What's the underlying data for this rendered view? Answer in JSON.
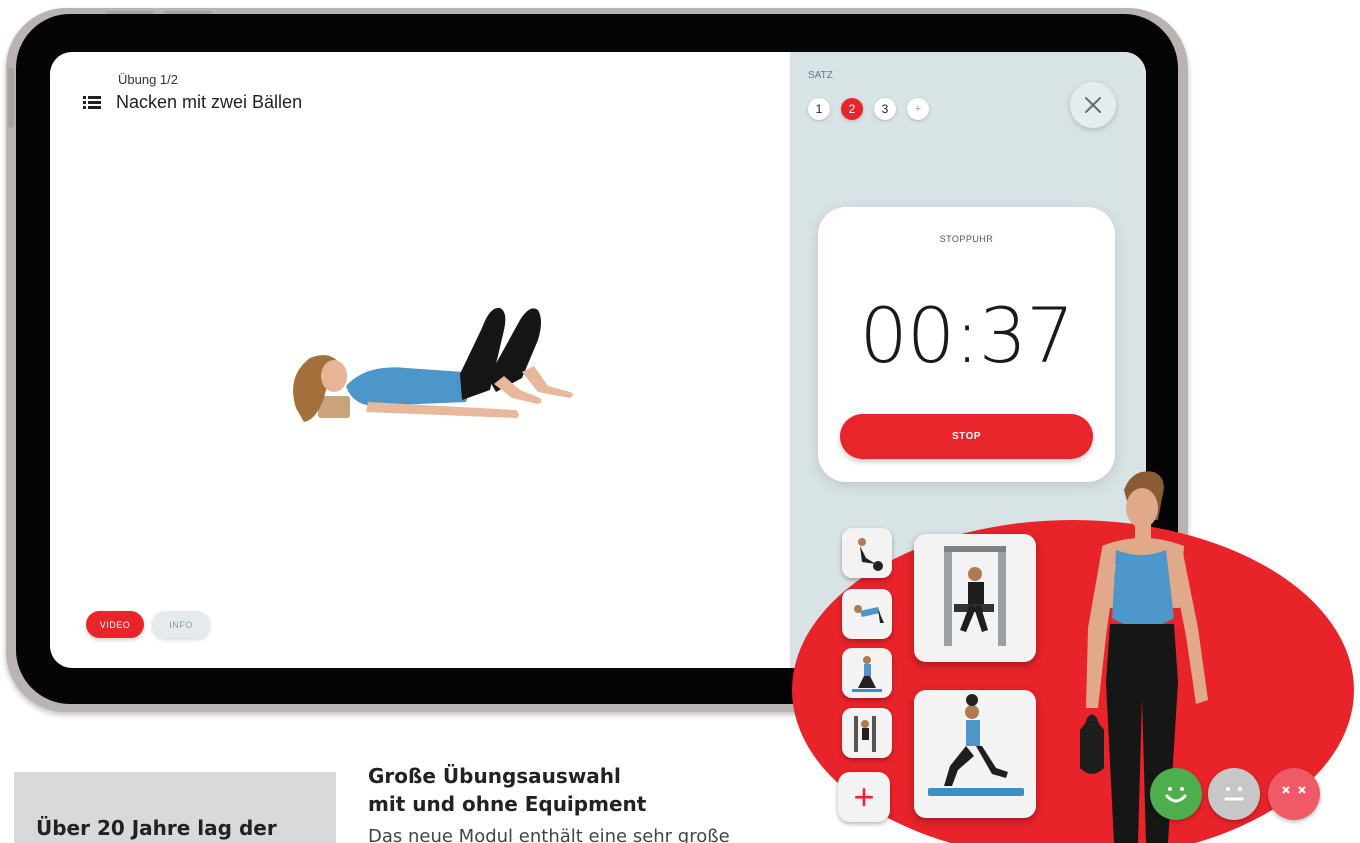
{
  "app": {
    "exercise_counter": "Übung 1/2",
    "exercise_title": "Nacken mit zwei Bällen",
    "tabs": [
      {
        "label": "VIDEO",
        "active": true
      },
      {
        "label": "INFO",
        "active": false
      }
    ]
  },
  "panel": {
    "satz_label": "SATZ",
    "sets": [
      {
        "label": "1",
        "active": false
      },
      {
        "label": "2",
        "active": true
      },
      {
        "label": "3",
        "active": false
      },
      {
        "label": "+",
        "active": false
      }
    ],
    "close_icon": "close-icon"
  },
  "timer": {
    "label": "STOPPUHR",
    "value": "00:37",
    "stop_label": "STOP"
  },
  "overlay": {
    "add_icon": "plus-icon",
    "rating_icons": [
      "smiley-happy-icon",
      "smiley-neutral-icon",
      "smiley-sad-icon"
    ]
  },
  "marketing": {
    "gray_box_text": "Über 20 Jahre lag der",
    "heading_line1": "Große Übungsauswahl",
    "heading_line2": "mit und ohne Equipment",
    "body": "Das neue Modul enthält eine sehr große"
  },
  "colors": {
    "accent_red": "#e8252b",
    "panel_bg": "#d8e3e6",
    "rating_green": "#4cae4c",
    "rating_gray": "#c7c7c7",
    "rating_red": "#f05a66"
  }
}
